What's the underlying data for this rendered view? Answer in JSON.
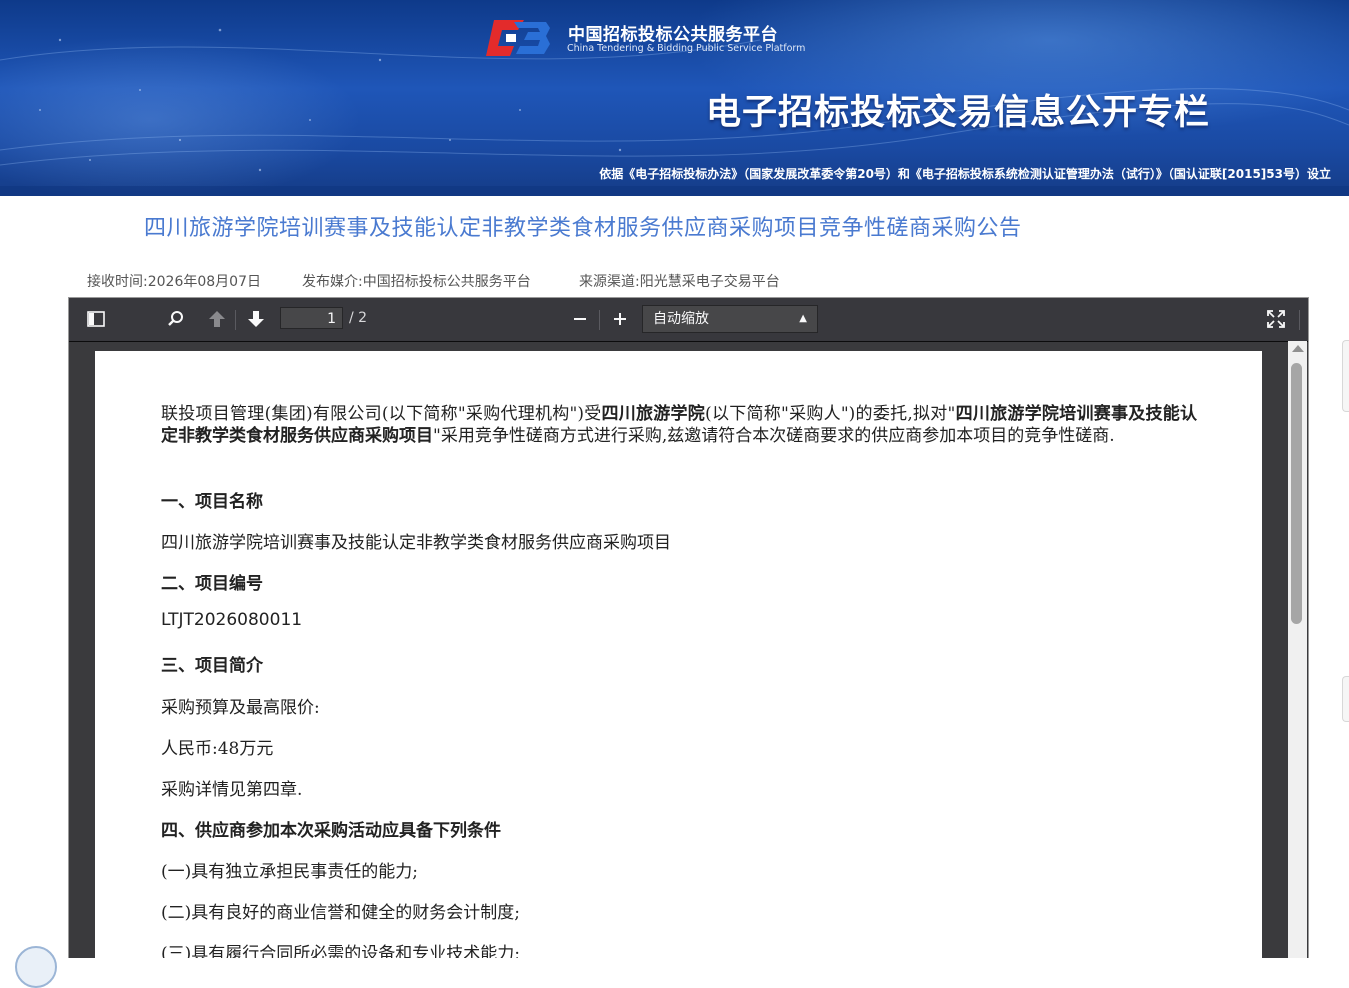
{
  "banner": {
    "logo_text_cn": "中国招标投标公共服务平台",
    "logo_text_en": "China Tendering & Bidding Public Service Platform",
    "title": "电子招标投标交易信息公开专栏",
    "basis": "依据《电子招标投标办法》（国家发展改革委令第20号）和《电子招标投标系统检测认证管理办法（试行）》（国认证联[2015]53号）设立"
  },
  "article": {
    "title": "四川旅游学院培训赛事及技能认定非教学类食材服务供应商采购项目竞争性磋商采购公告",
    "received": "接收时间:2026年08月07日",
    "publisher": "发布媒介:中国招标投标公共服务平台",
    "source": "来源渠道:阳光慧采电子交易平台"
  },
  "viewer": {
    "page_current": "1",
    "page_total": "/ 2",
    "zoom": "自动缩放"
  },
  "doc": {
    "intro_1": "联投项目管理(集团)有限公司(以下简称\"采购代理机构\")受",
    "intro_2": "四川旅游学院",
    "intro_3": "(以下简称\"采购人\")的委托,拟对\"",
    "intro_4": "四川旅游学院培训赛事及技能认定非教学类食材服务供应商采购项目",
    "intro_5": "\"采用竞争性磋商方式进行采购,兹邀请符合本次磋商要求的供应商参加本项目的竞争性磋商.",
    "h1": "一、项目名称",
    "project_name": "四川旅游学院培训赛事及技能认定非教学类食材服务供应商采购项目",
    "h2": "二、项目编号",
    "project_no": "LTJT2026080011",
    "h3": "三、项目简介",
    "budget_label": "采购预算及最高限价:",
    "budget_value": "人民币:48万元",
    "detail": "采购详情见第四章.",
    "h4": "四、供应商参加本次采购活动应具备下列条件",
    "cond_1": "(一)具有独立承担民事责任的能力;",
    "cond_2": "(二)具有良好的商业信誉和健全的财务会计制度;",
    "cond_3": "(三)具有履行合同所必需的设备和专业技术能力;"
  },
  "colors": {
    "banner_blue": "#1f56b8",
    "title_blue": "#4a7ad0",
    "toolbar": "#38383d",
    "logo_red": "#e32b2b"
  }
}
